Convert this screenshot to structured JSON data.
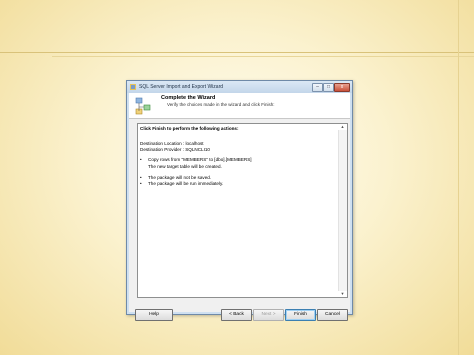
{
  "window": {
    "title": "SQL Server Import and Export Wizard",
    "controls": {
      "minimize": "–",
      "maximize": "□",
      "close": "x"
    }
  },
  "header": {
    "title": "Complete the Wizard",
    "subtitle": "Verify the choices made in the wizard and click Finish:"
  },
  "content": {
    "heading": "Click Finish to perform the following actions:",
    "destination_location": "Destination Location : localhost",
    "destination_provider": "Destination Provider : SQLNCLI10",
    "bullets": [
      "Copy rows from \"MEMBERS\" to [dbo].[MEMBERS]",
      "The package will not be saved."
    ],
    "sub_items": [
      "The new target table will be created.",
      "The package will be run immediately."
    ],
    "bullet_char": "•"
  },
  "buttons": {
    "help": "Help",
    "back": "< Back",
    "next": "Next >",
    "finish": "Finish",
    "cancel": "Cancel"
  },
  "icons": {
    "title_icon": "wizard-app-icon",
    "header_icon": "wizard-tree-icon"
  }
}
